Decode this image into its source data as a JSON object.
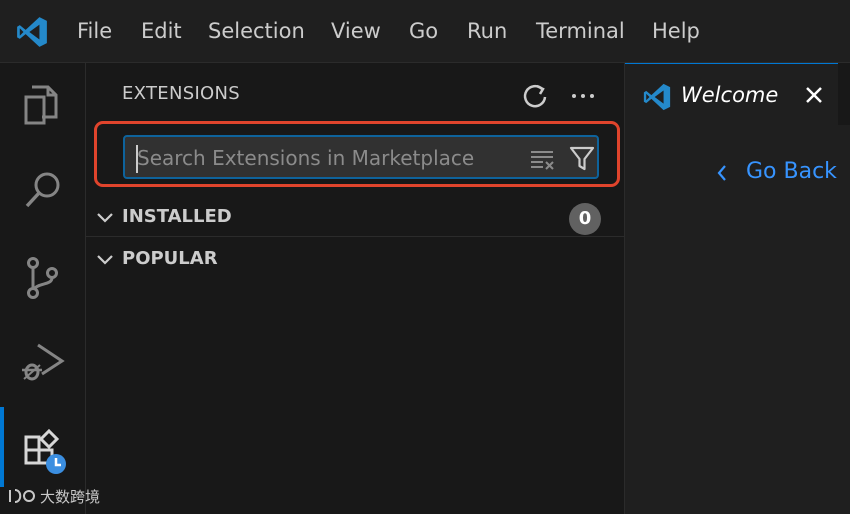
{
  "menubar": {
    "items": [
      "File",
      "Edit",
      "Selection",
      "View",
      "Go",
      "Run",
      "Terminal",
      "Help"
    ]
  },
  "activitybar": {
    "items": [
      {
        "icon": "explorer-icon"
      },
      {
        "icon": "search-icon"
      },
      {
        "icon": "source-control-icon"
      },
      {
        "icon": "run-debug-icon"
      },
      {
        "icon": "extensions-icon",
        "active": true
      }
    ]
  },
  "sidebar": {
    "title": "EXTENSIONS",
    "search": {
      "placeholder": "Search Extensions in Marketplace",
      "value": ""
    },
    "sections": [
      {
        "label": "INSTALLED",
        "count": "0"
      },
      {
        "label": "POPULAR"
      }
    ]
  },
  "editor": {
    "tab_label": "Welcome",
    "go_back": "Go Back"
  },
  "watermark": {
    "text": "大数跨境"
  },
  "colors": {
    "accent": "#0078d4",
    "highlight": "#e0442c",
    "link": "#3794ff",
    "vscode_blue": "#2489ca"
  }
}
